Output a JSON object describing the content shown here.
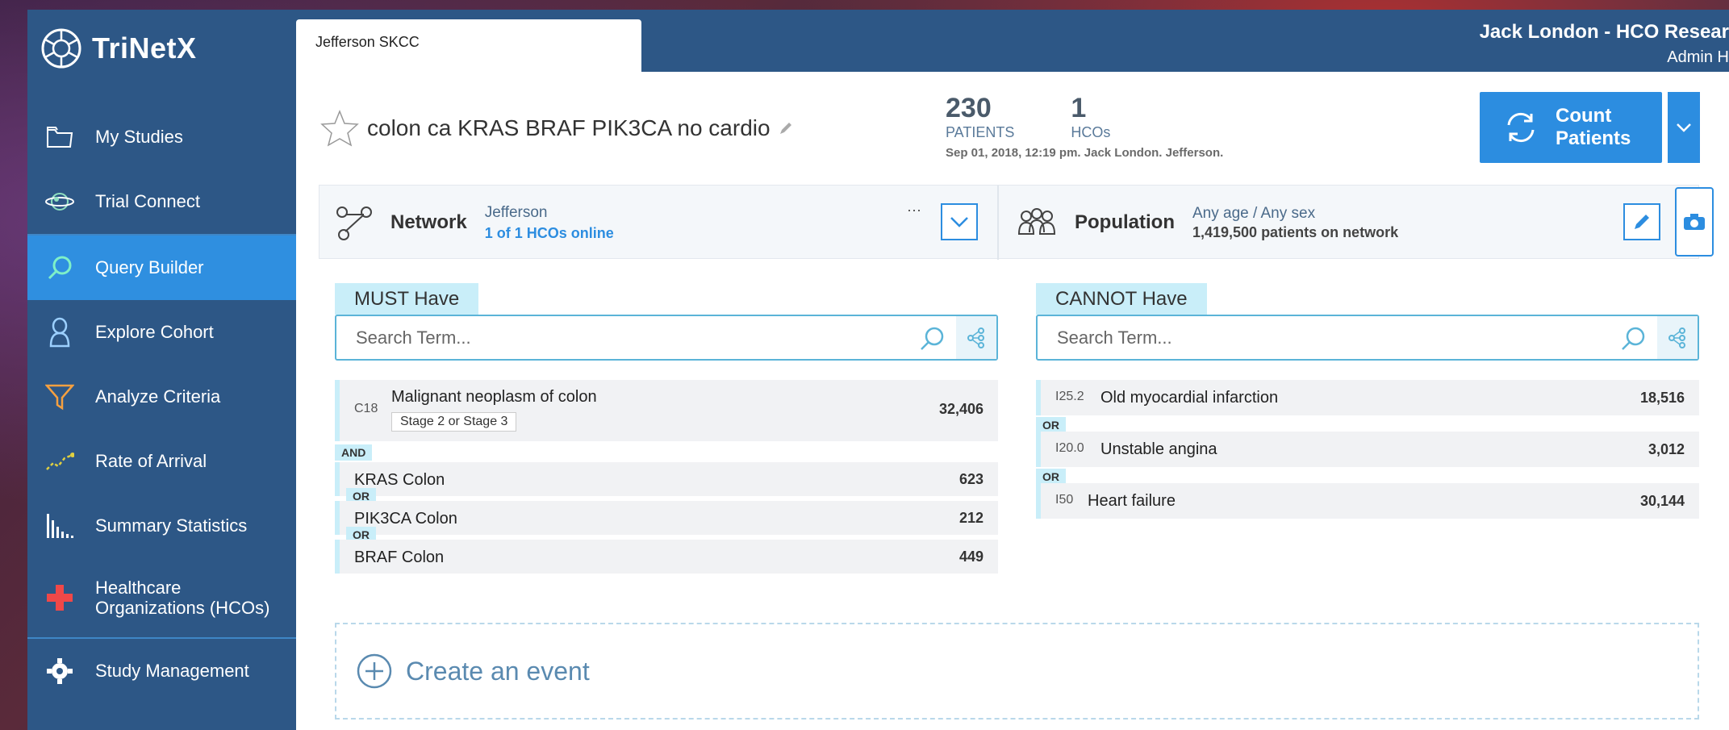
{
  "brand": {
    "name": "TriNetX"
  },
  "sidebar": {
    "items": [
      {
        "label": "My Studies",
        "icon": "folder-icon"
      },
      {
        "label": "Trial Connect",
        "icon": "globe-icon"
      },
      {
        "label": "Query Builder",
        "icon": "search-icon",
        "active": true
      },
      {
        "label": "Explore Cohort",
        "icon": "person-icon"
      },
      {
        "label": "Analyze Criteria",
        "icon": "filter-icon"
      },
      {
        "label": "Rate of Arrival",
        "icon": "trend-icon"
      },
      {
        "label": "Summary Statistics",
        "icon": "bar-chart-icon"
      },
      {
        "label": "Healthcare Organizations (HCOs)",
        "line1": "Healthcare",
        "line2": "Organizations (HCOs)",
        "icon": "plus-icon"
      },
      {
        "label": "Study Management",
        "icon": "gear-icon"
      }
    ]
  },
  "topbar": {
    "tab_label": "Jefferson SKCC",
    "user_name": "Jack London - HCO Resear",
    "user_links": "Admin  H"
  },
  "study": {
    "title": "colon ca KRAS BRAF PIK3CA no cardio",
    "patients_count": "230",
    "patients_label": "PATIENTS",
    "hcos_count": "1",
    "hcos_label": "HCOs",
    "meta": "Sep 01, 2018, 12:19 pm.   Jack London.   Jefferson.",
    "count_button_line1": "Count",
    "count_button_line2": "Patients"
  },
  "network": {
    "title": "Network",
    "value": "Jefferson",
    "status": "1 of 1 HCOs online",
    "more": "···"
  },
  "population": {
    "title": "Population",
    "value": "Any age / Any sex",
    "detail": "1,419,500 patients on network"
  },
  "must_have": {
    "label": "MUST Have",
    "search_placeholder": "Search Term...",
    "criteria": [
      {
        "code": "C18",
        "name": "Malignant neoplasm of colon",
        "tag": "Stage 2 or Stage 3",
        "count": "32,406"
      },
      {
        "name": "KRAS Colon",
        "count": "623"
      },
      {
        "name": "PIK3CA Colon",
        "count": "212"
      },
      {
        "name": "BRAF Colon",
        "count": "449"
      }
    ],
    "and_label": "AND",
    "or_label": "OR"
  },
  "cannot_have": {
    "label": "CANNOT Have",
    "search_placeholder": "Search Term...",
    "criteria": [
      {
        "code": "I25.2",
        "name": "Old myocardial infarction",
        "count": "18,516"
      },
      {
        "code": "I20.0",
        "name": "Unstable angina",
        "count": "3,012"
      },
      {
        "code": "I50",
        "name": "Heart failure",
        "count": "30,144"
      }
    ],
    "or_label": "OR"
  },
  "create_event": {
    "label": "Create an event"
  },
  "colors": {
    "sidebar": "#2d5786",
    "accent": "#2c8de0",
    "active": "#2f8fe0",
    "label_bg": "#c9eef9"
  }
}
